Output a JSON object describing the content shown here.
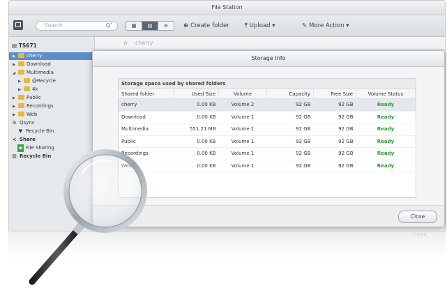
{
  "window": {
    "title": "File Station"
  },
  "toolbar": {
    "search_placeholder": "Search",
    "search_icon": "Q˅",
    "view_buttons": [
      "▦",
      "▤",
      "≡"
    ],
    "create_folder": "Create folder",
    "upload": "Upload",
    "more_action": "More Action",
    "icons": {
      "create": "plus-circle-icon",
      "upload": "upload-icon",
      "more": "wrench-icon"
    }
  },
  "sidebar": {
    "nas_name": "TS671",
    "items": [
      {
        "label": "cherry",
        "level": 1,
        "selected": true
      },
      {
        "label": "Download",
        "level": 1
      },
      {
        "label": "Multimedia",
        "level": 1,
        "expanded": true
      },
      {
        "label": "@Recycle",
        "level": 2
      },
      {
        "label": "4k",
        "level": 2
      },
      {
        "label": "Public",
        "level": 1
      },
      {
        "label": "Recordings",
        "level": 1
      },
      {
        "label": "Web",
        "level": 1
      },
      {
        "label": "Qsync",
        "level": 0
      },
      {
        "label": "Recycle Bin",
        "level": 1
      },
      {
        "label": "Share",
        "level": 0
      },
      {
        "label": "File Sharing",
        "level": 1
      },
      {
        "label": "Recycle Bin",
        "level": 0
      }
    ]
  },
  "pathbar": {
    "path": "cherry"
  },
  "modal": {
    "title": "Storage Info",
    "panel_title": "Storage space used by shared folders",
    "columns": [
      "Shared folder",
      "Used Size",
      "Volume",
      "Capacity",
      "Free Size",
      "Volume Status"
    ],
    "rows": [
      [
        "cherry",
        "0.00 KB",
        "Volume 2",
        "92 GB",
        "92 GB",
        "Ready"
      ],
      [
        "Download",
        "0.00 KB",
        "Volume 1",
        "92 GB",
        "92 GB",
        "Ready"
      ],
      [
        "Multimedia",
        "551.21 MB",
        "Volume 1",
        "92 GB",
        "92 GB",
        "Ready"
      ],
      [
        "Public",
        "0.00 KB",
        "Volume 1",
        "92 GB",
        "92 GB",
        "Ready"
      ],
      [
        "Recordings",
        "0.00 KB",
        "Volume 1",
        "92 GB",
        "92 GB",
        "Ready"
      ],
      [
        "Web",
        "0.00 KB",
        "Volume 1",
        "92 GB",
        "92 GB",
        "Ready"
      ]
    ],
    "close_label": "Close",
    "ready_color": "#2e9b33"
  },
  "colors": {
    "selection": "#5a8fc8",
    "folder": "#e9b73a"
  }
}
